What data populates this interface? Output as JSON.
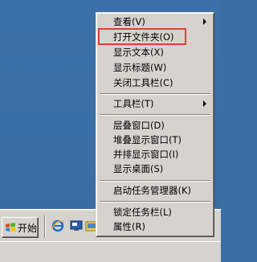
{
  "menu": {
    "items": [
      {
        "label": "查看(V)",
        "submenu": true
      },
      {
        "label": "打开文件夹(O)",
        "submenu": false,
        "highlighted": true
      },
      {
        "label": "显示文本(X)",
        "submenu": false
      },
      {
        "label": "显示标题(W)",
        "submenu": false
      },
      {
        "label": "关闭工具栏(C)",
        "submenu": false
      },
      {
        "label": "工具栏(T)",
        "submenu": true
      },
      {
        "label": "层叠窗口(D)",
        "submenu": false
      },
      {
        "label": "堆叠显示窗口(T)",
        "submenu": false
      },
      {
        "label": "并排显示窗口(I)",
        "submenu": false
      },
      {
        "label": "显示桌面(S)",
        "submenu": false
      },
      {
        "label": "启动任务管理器(K)",
        "submenu": false
      },
      {
        "label": "锁定任务栏(L)",
        "submenu": false
      },
      {
        "label": "属性(R)",
        "submenu": false
      }
    ],
    "highlight_color": "#e63a3a"
  },
  "taskbar": {
    "start_label": "开始",
    "quicklaunch_icons": [
      "ie-icon",
      "show-desktop-icon",
      "explorer-icon"
    ]
  },
  "colors": {
    "desktop": "#3a6ea5",
    "menu_bg": "#d6d3ce"
  }
}
